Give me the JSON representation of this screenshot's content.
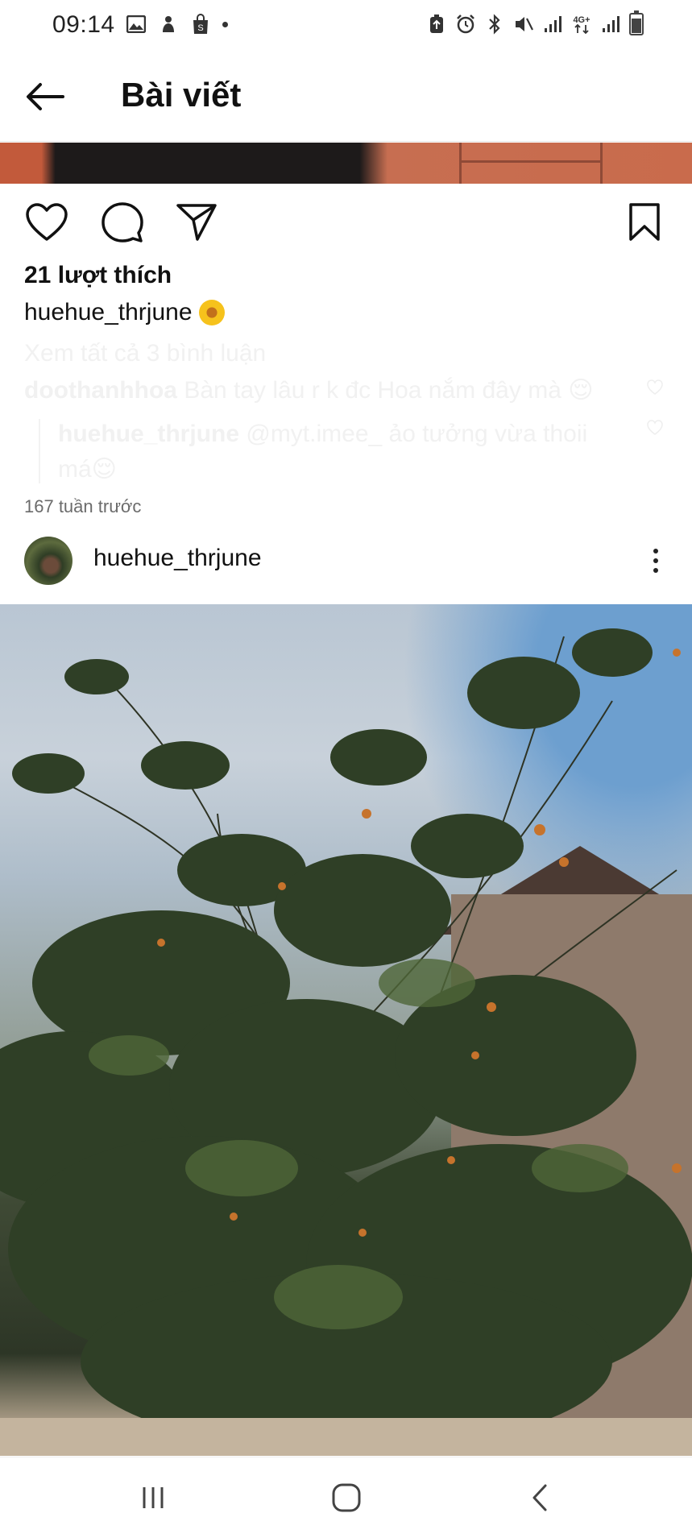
{
  "status_bar": {
    "time": "09:14"
  },
  "app_bar": {
    "title": "Bài viết"
  },
  "post_actions": {
    "icons": [
      "heart-icon",
      "comment-icon",
      "send-icon",
      "bookmark-icon"
    ]
  },
  "likes": "21 lượt thích",
  "caption": {
    "username": "huehue_thrjune",
    "emoji": "🌼"
  },
  "comments": {
    "view_all": "Xem tất cả 3 bình luận",
    "items": [
      {
        "username": "doothanhhoa",
        "text": "Bàn tay lâu r k đc Hoa nắm đây mà 😌"
      }
    ],
    "replies": [
      {
        "username": "huehue_thrjune",
        "text": "@myt.imee_ ảo tưởng vừa thoii má😌"
      }
    ]
  },
  "time_ago": "167 tuần trước",
  "next_post": {
    "username": "huehue_thrjune"
  },
  "colors": {
    "faded_text": "#f1f1f1",
    "secondary_text": "#6b6b6b"
  }
}
